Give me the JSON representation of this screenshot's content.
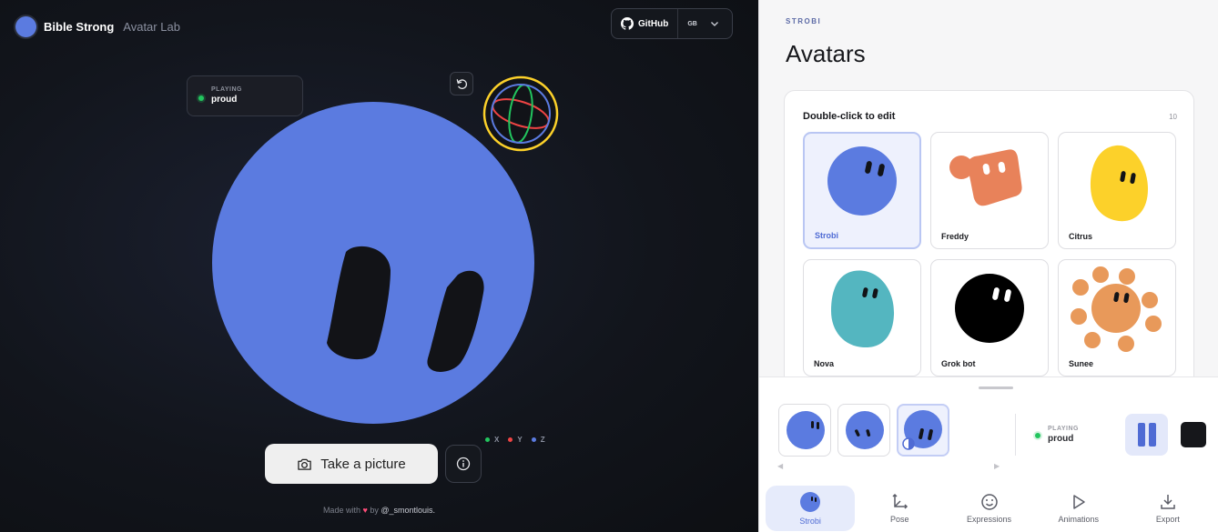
{
  "brand": {
    "name": "Bible Strong",
    "subtitle": "Avatar Lab",
    "accent": "#5b7be0"
  },
  "header": {
    "github_label": "GitHub",
    "language": "GB"
  },
  "stage": {
    "playing_label": "PLAYING",
    "playing_value": "proud",
    "axes": [
      {
        "label": "X",
        "color": "#22c55e"
      },
      {
        "label": "Y",
        "color": "#ef4444"
      },
      {
        "label": "Z",
        "color": "#5b7be0"
      }
    ],
    "snap_button": "Take a picture",
    "credit_prefix": "Made with",
    "credit_by": "by",
    "credit_handle": "@_smontlouis."
  },
  "panel": {
    "crumb": "STROBI",
    "title": "Avatars",
    "card_heading": "Double-click to edit",
    "count": "10",
    "avatars": [
      {
        "name": "Strobi",
        "color": "#5b7be0",
        "selected": true
      },
      {
        "name": "Freddy",
        "color": "#e8825a"
      },
      {
        "name": "Citrus",
        "color": "#fcd12a"
      },
      {
        "name": "Nova",
        "color": "#54b6c0"
      },
      {
        "name": "Grok bot",
        "color": "#000000"
      },
      {
        "name": "Sunee",
        "color": "#e8995a"
      }
    ]
  },
  "tray": {
    "playing_label": "PLAYING",
    "playing_value": "proud",
    "nav": [
      {
        "label": "Strobi",
        "icon": "avatar-icon",
        "active": true
      },
      {
        "label": "Pose",
        "icon": "axes-icon"
      },
      {
        "label": "Expressions",
        "icon": "smile-icon"
      },
      {
        "label": "Animations",
        "icon": "play-icon"
      },
      {
        "label": "Export",
        "icon": "download-icon"
      }
    ]
  }
}
